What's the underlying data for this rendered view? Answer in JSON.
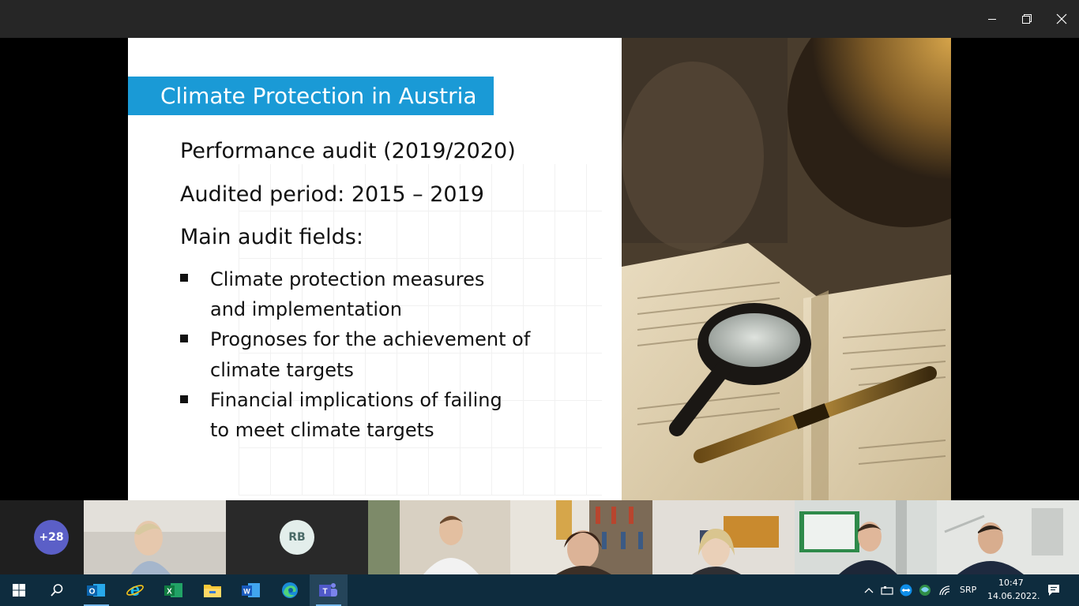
{
  "window": {
    "controls": {
      "minimize": "minimize-icon",
      "restore": "restore-icon",
      "close": "close-icon"
    }
  },
  "slide": {
    "title": "Climate Protection in Austria",
    "accent_color": "#1a9ad6",
    "lines": [
      "Performance audit (2019/2020)",
      "Audited period: 2015 – 2019",
      "Main audit fields:"
    ],
    "bullets": [
      {
        "line1": "Climate protection measures",
        "line2": "and implementation"
      },
      {
        "line1": "Prognoses for the achievement of",
        "line2": "climate targets"
      },
      {
        "line1": "Financial implications of failing",
        "line2": "to meet climate targets"
      }
    ]
  },
  "participants": {
    "overflow_count": "+28",
    "rb_initials": "RB"
  },
  "taskbar": {
    "apps": [
      "start-icon",
      "search-icon",
      "outlook-icon",
      "internet-explorer-icon",
      "excel-icon",
      "file-explorer-icon",
      "word-icon",
      "edge-icon",
      "teams-icon"
    ],
    "language": "SRP",
    "time": "10:47",
    "date": "14.06.2022."
  }
}
